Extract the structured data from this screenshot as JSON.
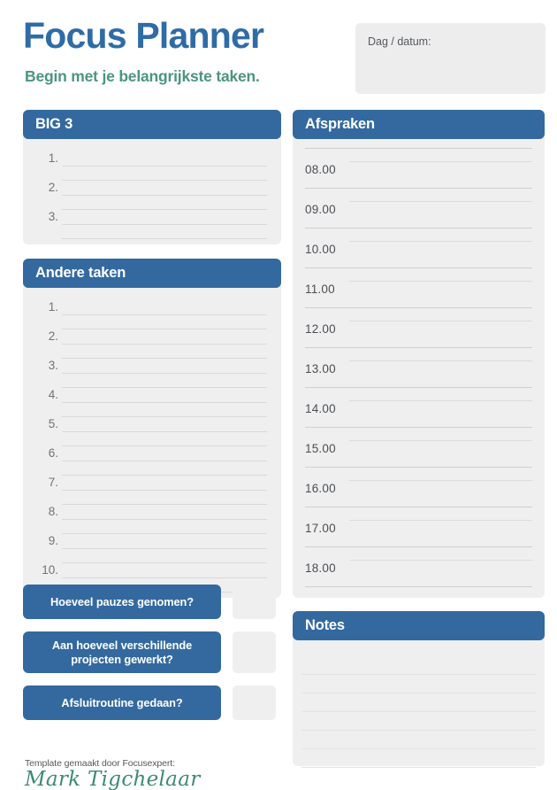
{
  "header": {
    "title": "Focus Planner",
    "subtitle": "Begin met je belangrijkste taken.",
    "date_label": "Dag / datum:",
    "date_value": ""
  },
  "colors": {
    "brand_blue": "#33699f",
    "title_blue": "#2f6ca6",
    "accent_green": "#4c9580",
    "card_gray": "#efeff0",
    "rule_gray": "#d9d9db"
  },
  "big3": {
    "heading": "BIG 3",
    "items": [
      {
        "num": "1.",
        "value": ""
      },
      {
        "num": "2.",
        "value": ""
      },
      {
        "num": "3.",
        "value": ""
      }
    ]
  },
  "other_tasks": {
    "heading": "Andere taken",
    "items": [
      {
        "num": "1.",
        "value": ""
      },
      {
        "num": "2.",
        "value": ""
      },
      {
        "num": "3.",
        "value": ""
      },
      {
        "num": "4.",
        "value": ""
      },
      {
        "num": "5.",
        "value": ""
      },
      {
        "num": "6.",
        "value": ""
      },
      {
        "num": "7.",
        "value": ""
      },
      {
        "num": "8.",
        "value": ""
      },
      {
        "num": "9.",
        "value": ""
      },
      {
        "num": "10.",
        "value": ""
      }
    ]
  },
  "appointments": {
    "heading": "Afspraken",
    "slots": [
      {
        "time": "08.00",
        "value": ""
      },
      {
        "time": "09.00",
        "value": ""
      },
      {
        "time": "10.00",
        "value": ""
      },
      {
        "time": "11.00",
        "value": ""
      },
      {
        "time": "12.00",
        "value": ""
      },
      {
        "time": "13.00",
        "value": ""
      },
      {
        "time": "14.00",
        "value": ""
      },
      {
        "time": "15.00",
        "value": ""
      },
      {
        "time": "16.00",
        "value": ""
      },
      {
        "time": "17.00",
        "value": ""
      },
      {
        "time": "18.00",
        "value": ""
      }
    ]
  },
  "questions": [
    {
      "label": "Hoeveel pauzes genomen?",
      "answer": ""
    },
    {
      "label": "Aan hoeveel verschillende projecten gewerkt?",
      "answer": ""
    },
    {
      "label": "Afsluitroutine gedaan?",
      "answer": ""
    }
  ],
  "notes": {
    "heading": "Notes",
    "value": ""
  },
  "footer": {
    "credit": "Template gemaakt door Focusexpert:",
    "signature": "Mark Tigchelaar"
  }
}
